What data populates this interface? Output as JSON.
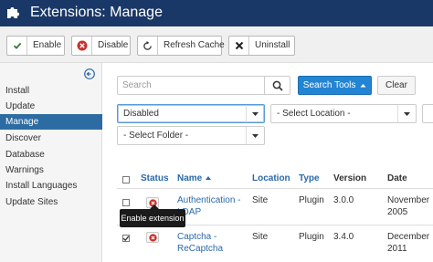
{
  "header": {
    "title": "Extensions: Manage"
  },
  "toolbar": {
    "enable_label": "Enable",
    "disable_label": "Disable",
    "refresh_label": "Refresh Cache",
    "uninstall_label": "Uninstall"
  },
  "sidebar": {
    "items": [
      {
        "label": "Install"
      },
      {
        "label": "Update"
      },
      {
        "label": "Manage"
      },
      {
        "label": "Discover"
      },
      {
        "label": "Database"
      },
      {
        "label": "Warnings"
      },
      {
        "label": "Install Languages"
      },
      {
        "label": "Update Sites"
      }
    ],
    "active": "Manage"
  },
  "search": {
    "placeholder": "Search",
    "search_tools_label": "Search Tools",
    "clear_label": "Clear"
  },
  "filters": {
    "status": "Disabled",
    "location": "- Select Location -",
    "folder": "- Select Folder -"
  },
  "table": {
    "headers": {
      "status": "Status",
      "name": "Name",
      "location": "Location",
      "type": "Type",
      "version": "Version",
      "date": "Date"
    },
    "rows": [
      {
        "name_line1": "Authentication -",
        "name_line2": "LDAP",
        "location": "Site",
        "type": "Plugin",
        "version": "3.0.0",
        "date_line1": "November",
        "date_line2": "2005",
        "checked": false
      },
      {
        "name_line1": "Captcha -",
        "name_line2": "ReCaptcha",
        "location": "Site",
        "type": "Plugin",
        "version": "3.4.0",
        "date_line1": "December",
        "date_line2": "2011",
        "checked": true
      }
    ]
  },
  "tooltip": {
    "text": "Enable extension"
  },
  "colors": {
    "header_bg": "#1a3867",
    "primary": "#2384d3",
    "active_nav": "#2d6ca2",
    "disable_red": "#c9302c",
    "enable_green": "#3c763d"
  }
}
